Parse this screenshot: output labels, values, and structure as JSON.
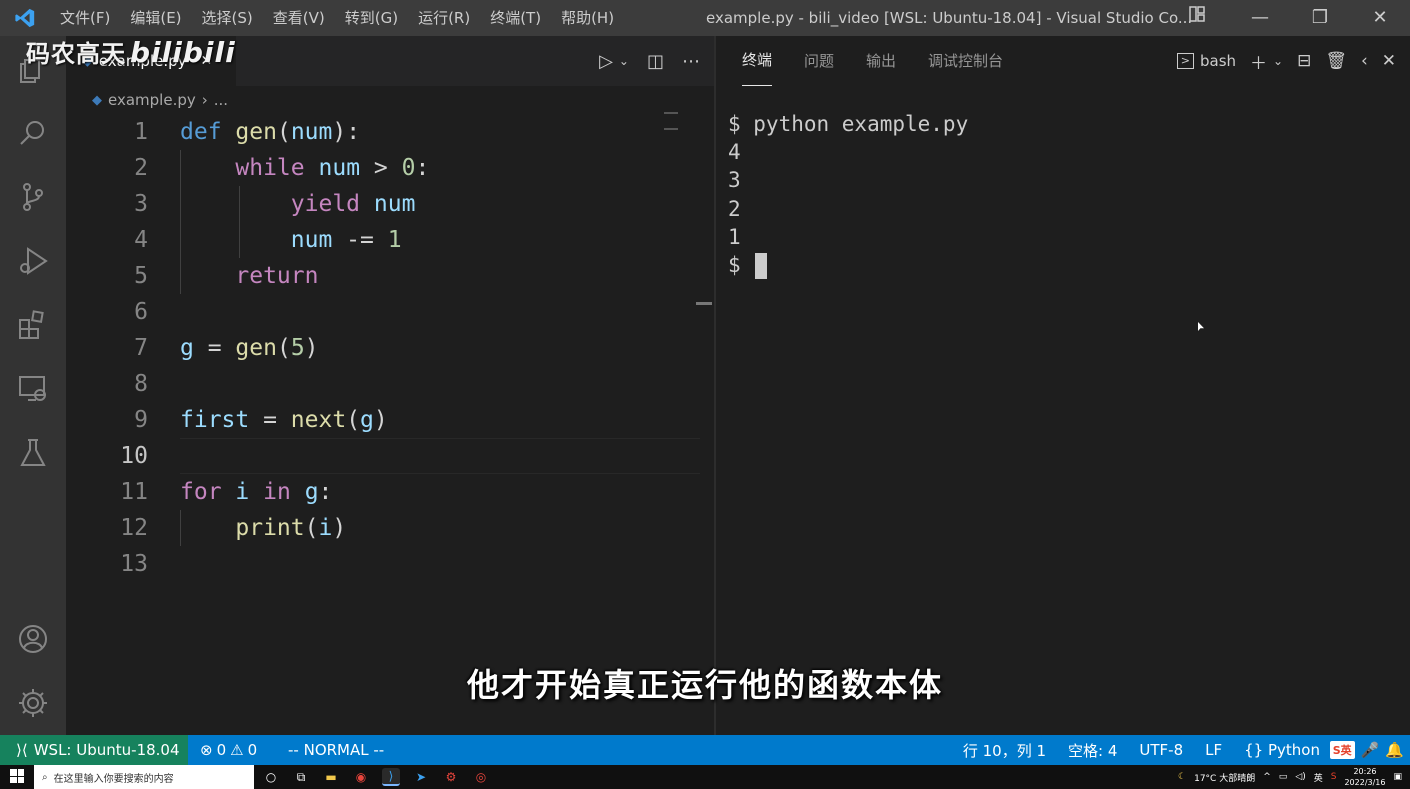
{
  "titlebar": {
    "menu": [
      "文件(F)",
      "编辑(E)",
      "选择(S)",
      "查看(V)",
      "转到(G)",
      "运行(R)",
      "终端(T)",
      "帮助(H)"
    ],
    "title": "example.py - bili_video [WSL: Ubuntu-18.04] - Visual Studio Co...",
    "minimize": "—",
    "restore": "❐",
    "close": "✕"
  },
  "watermark": {
    "text": "码农高天",
    "brand": "bilibili"
  },
  "editor": {
    "tab_label": "example.py",
    "breadcrumb_file": "example.py",
    "breadcrumb_rest": "...",
    "active_line": 10,
    "lines": [
      {
        "n": "1"
      },
      {
        "n": "2"
      },
      {
        "n": "3"
      },
      {
        "n": "4"
      },
      {
        "n": "5"
      },
      {
        "n": "6"
      },
      {
        "n": "7"
      },
      {
        "n": "8"
      },
      {
        "n": "9"
      },
      {
        "n": "10"
      },
      {
        "n": "11"
      },
      {
        "n": "12"
      },
      {
        "n": "13"
      }
    ]
  },
  "panel": {
    "tabs": [
      "终端",
      "问题",
      "输出",
      "调试控制台"
    ],
    "shell": "bash",
    "terminal_lines": [
      "$ python example.py",
      "4",
      "3",
      "2",
      "1",
      "$ "
    ]
  },
  "subtitle": "他才开始真正运行他的函数本体",
  "statusbar": {
    "remote": "WSL: Ubuntu-18.04",
    "errors": "0",
    "warnings": "0",
    "vim_mode": "-- NORMAL --",
    "position": "行 10，列 1",
    "spaces": "空格: 4",
    "encoding": "UTF-8",
    "eol": "LF",
    "language": "Python",
    "ime": "S英"
  },
  "taskbar": {
    "search_placeholder": "在这里输入你要搜索的内容",
    "weather": "17°C 大部晴朗",
    "ime": "英",
    "time": "20:26",
    "date": "2022/3/16"
  },
  "colors": {
    "statusbar": "#007acc",
    "remote": "#16825d",
    "keyword": "#c586c0",
    "function": "#dcdcaa",
    "variable": "#9cdcfe",
    "number": "#b5cea8"
  }
}
